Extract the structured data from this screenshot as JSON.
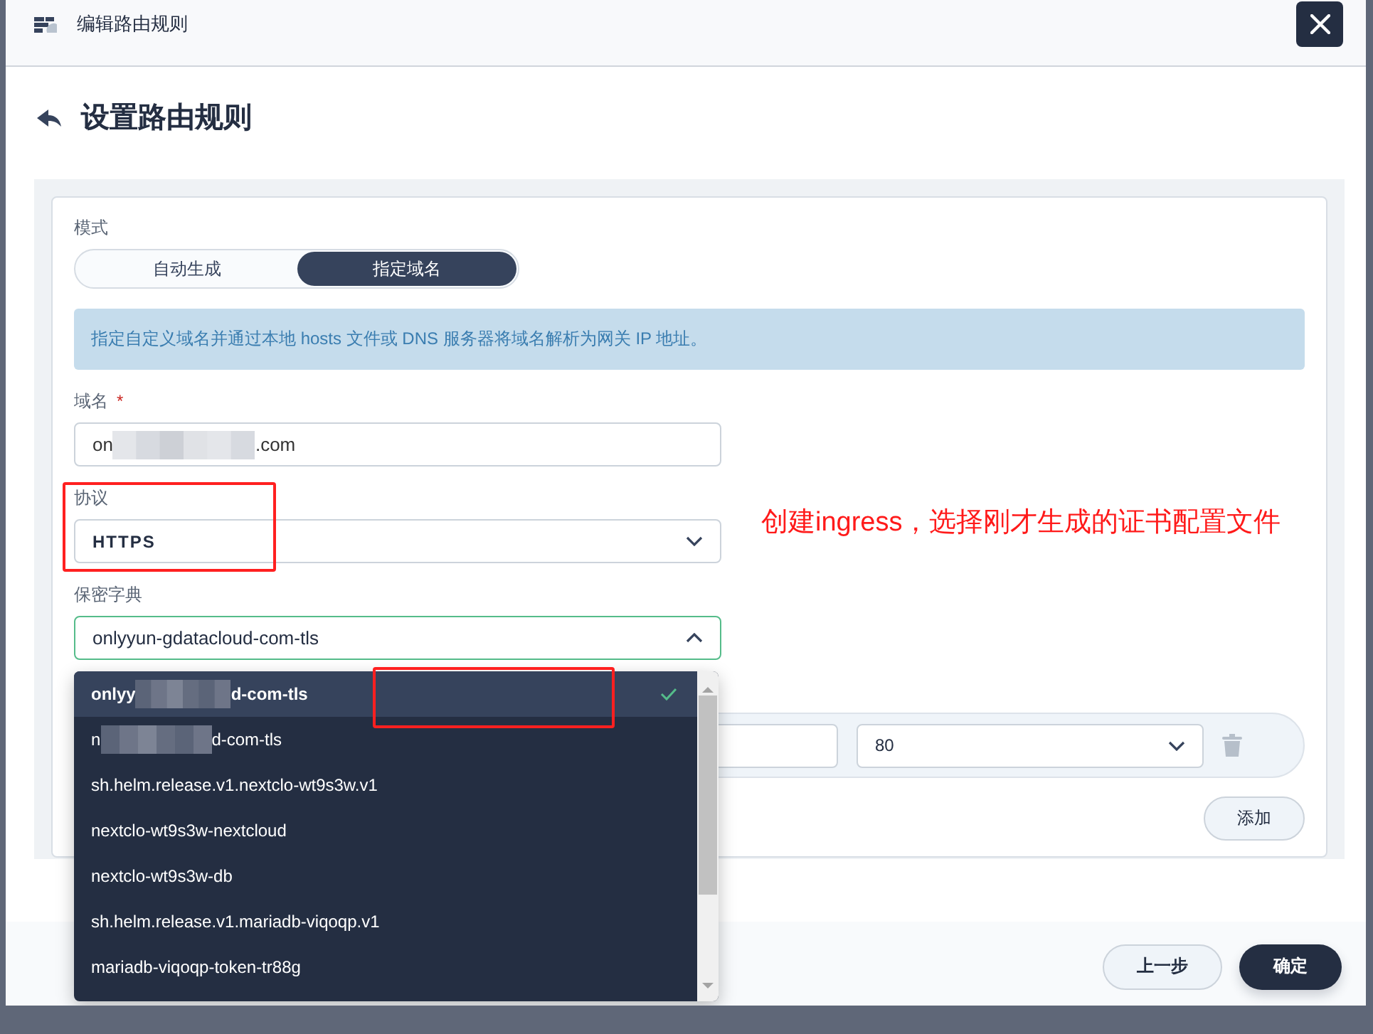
{
  "window": {
    "title": "编辑路由规则"
  },
  "page_title": "设置路由规则",
  "mode": {
    "label": "模式",
    "options": [
      {
        "label": "自动生成",
        "selected": false
      },
      {
        "label": "指定域名",
        "selected": true
      }
    ]
  },
  "info": "指定自定义域名并通过本地 hosts 文件或 DNS 服务器将域名解析为网关 IP 地址。",
  "domain": {
    "label": "域名",
    "required": true,
    "required_mark": "*",
    "value_parts": [
      "on",
      ".com"
    ]
  },
  "protocol": {
    "label": "协议",
    "value": "HTTPS"
  },
  "secret": {
    "label": "保密字典",
    "value": "onlyyun-gdatacloud-com-tls",
    "expanded": true,
    "options": [
      {
        "parts": [
          "onlyy",
          "d-com-tls"
        ],
        "selected": true
      },
      {
        "parts": [
          "n",
          "d-com-tls"
        ],
        "selected": false
      },
      {
        "parts": [
          "sh.helm.release.v1.nextclo-wt9s3w.v1"
        ],
        "selected": false
      },
      {
        "parts": [
          "nextclo-wt9s3w-nextcloud"
        ],
        "selected": false
      },
      {
        "parts": [
          "nextclo-wt9s3w-db"
        ],
        "selected": false
      },
      {
        "parts": [
          "sh.helm.release.v1.mariadb-viqoqp.v1"
        ],
        "selected": false
      },
      {
        "parts": [
          "mariadb-viqoqp-token-tr88g"
        ],
        "selected": false
      }
    ]
  },
  "path_row": {
    "port": "80"
  },
  "add_button": "添加",
  "footer": {
    "buttons": [
      {
        "label": "上一步",
        "kind": "secondary"
      },
      {
        "label": "确定",
        "kind": "primary"
      }
    ]
  },
  "annotation": {
    "text": "创建ingress，选择刚才生成的证书配置文件"
  }
}
